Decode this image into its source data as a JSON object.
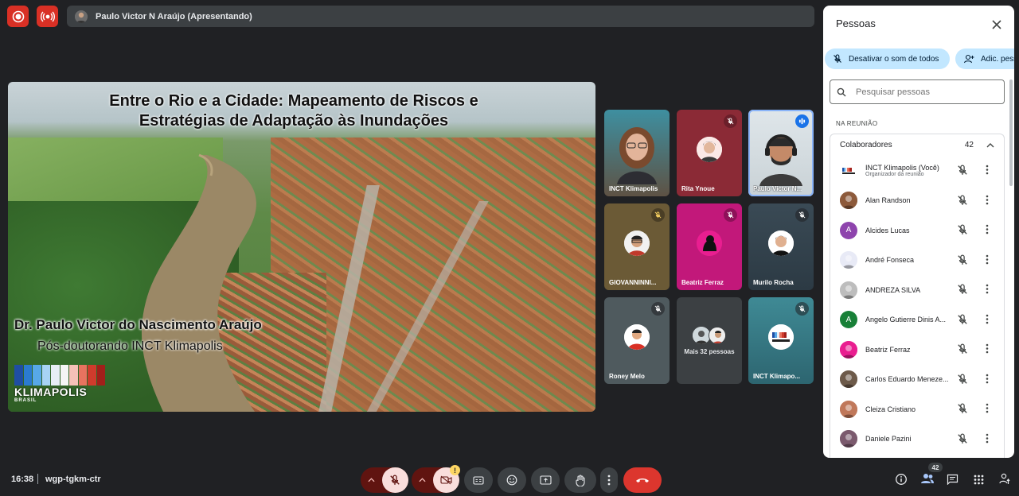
{
  "topbar": {
    "presenter_text": "Paulo Victor N Araújo (Apresentando)"
  },
  "slide": {
    "title_line1": "Entre o Rio e a Cidade: Mapeamento de Riscos e",
    "title_line2": "Estratégias de Adaptação às Inundações",
    "author": "Dr. Paulo Victor do Nascimento Araújo",
    "role": "Pós-doutorando INCT Klimapolis",
    "logo_word": "KLIMAPOLIS",
    "logo_sub": "BRASIL"
  },
  "tiles": [
    {
      "name": "INCT Klimapolis"
    },
    {
      "name": "Rita Ynoue"
    },
    {
      "name": "Paulo Victor N..."
    },
    {
      "name": "GIOVANNINNI..."
    },
    {
      "name": "Beatriz Ferraz"
    },
    {
      "name": "Murilo Rocha"
    },
    {
      "name": "Roney Melo"
    },
    {
      "name": "Mais 32 pessoas"
    },
    {
      "name": "INCT Klimapo..."
    }
  ],
  "panel": {
    "title": "Pessoas",
    "mute_all": "Desativar o som de todos",
    "add_people": "Adic. pess",
    "search_placeholder": "Pesquisar pessoas",
    "section_label": "NA REUNIÃO",
    "group_label": "Colaboradores",
    "group_count": "42",
    "participants": [
      {
        "name": "INCT Klimapolis (Você)",
        "sub": "Organizador da reunião",
        "initial": "",
        "color": "#ffffff"
      },
      {
        "name": "Alan Randson",
        "sub": "",
        "initial": "",
        "color": "#8d5a3b"
      },
      {
        "name": "Alcides Lucas",
        "sub": "",
        "initial": "A",
        "color": "#8e44ad"
      },
      {
        "name": "André Fonseca",
        "sub": "",
        "initial": "",
        "color": "#e8eaf6"
      },
      {
        "name": "ANDREZA SILVA",
        "sub": "",
        "initial": "",
        "color": "#bdbdbd"
      },
      {
        "name": "Angelo Gutierre Dinis A...",
        "sub": "",
        "initial": "A",
        "color": "#188038"
      },
      {
        "name": "Beatriz Ferraz",
        "sub": "",
        "initial": "",
        "color": "#e91e90"
      },
      {
        "name": "Carlos Eduardo Meneze...",
        "sub": "",
        "initial": "",
        "color": "#6d5a4a"
      },
      {
        "name": "Cleiza Cristiano",
        "sub": "",
        "initial": "",
        "color": "#c0785a"
      },
      {
        "name": "Daniele Pazini",
        "sub": "",
        "initial": "",
        "color": "#7b5a6e"
      }
    ]
  },
  "bottom": {
    "time": "16:38",
    "meeting_code": "wgp-tgkm-ctr",
    "people_count": "42",
    "warning": "!"
  },
  "colors": {
    "accent": "#8ab4f8",
    "end_call": "#dc362e",
    "chip": "#c2e7ff"
  }
}
